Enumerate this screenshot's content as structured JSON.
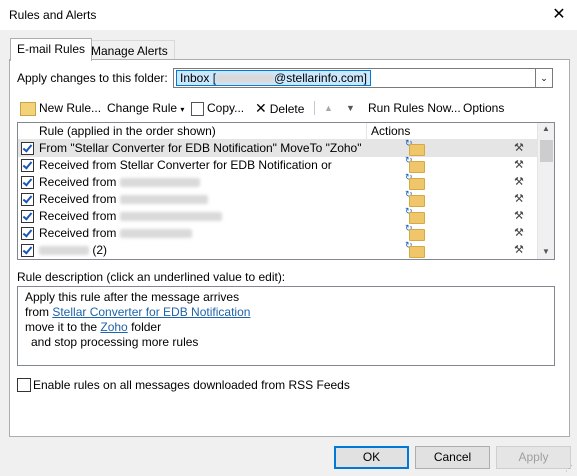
{
  "window": {
    "title": "Rules and Alerts",
    "close_glyph": "✕"
  },
  "tabs": [
    {
      "label": "E-mail Rules",
      "active": true
    },
    {
      "label": "Manage Alerts",
      "active": false
    }
  ],
  "folder": {
    "label": "Apply changes to this folder:",
    "value_prefix": "Inbox [",
    "value_suffix": "@stellarinfo.com]",
    "dropdown_glyph": "⌄"
  },
  "toolbar": {
    "new_rule": "New Rule...",
    "change_rule": "Change Rule",
    "copy": "Copy...",
    "delete": "Delete",
    "move_up_glyph": "▲",
    "move_down_glyph": "▼",
    "run_rules_now": "Run Rules Now...",
    "options": "Options"
  },
  "rules_grid": {
    "col_rule": "Rule (applied in the order shown)",
    "col_actions": "Actions",
    "rows": [
      {
        "text": "From \"Stellar Converter for EDB Notification\" MoveTo \"Zoho\"",
        "checked": true,
        "selected": true
      },
      {
        "text": "Received from Stellar Converter for EDB Notification or",
        "checked": true,
        "selected": false
      },
      {
        "text": "Received from",
        "checked": true,
        "selected": false
      },
      {
        "text": "Received from",
        "checked": true,
        "selected": false
      },
      {
        "text": "Received from",
        "checked": true,
        "selected": false
      },
      {
        "text": "Received from",
        "checked": true,
        "selected": false
      },
      {
        "text": "(2)",
        "checked": true,
        "selected": false
      }
    ]
  },
  "description": {
    "label": "Rule description (click an underlined value to edit):",
    "line1": "Apply this rule after the message arrives",
    "line2_prefix": "from ",
    "line2_link": "Stellar Converter for EDB Notification",
    "line3_prefix": "move it to the ",
    "line3_link": "Zoho",
    "line3_suffix": " folder",
    "line4": "and stop processing more rules"
  },
  "rss": {
    "label": "Enable rules on all messages downloaded from RSS Feeds",
    "checked": false
  },
  "buttons": {
    "ok": "OK",
    "cancel": "Cancel",
    "apply": "Apply"
  },
  "colors": {
    "accent": "#0078d7",
    "link": "#1f63a8",
    "selection": "#cce8ff"
  }
}
